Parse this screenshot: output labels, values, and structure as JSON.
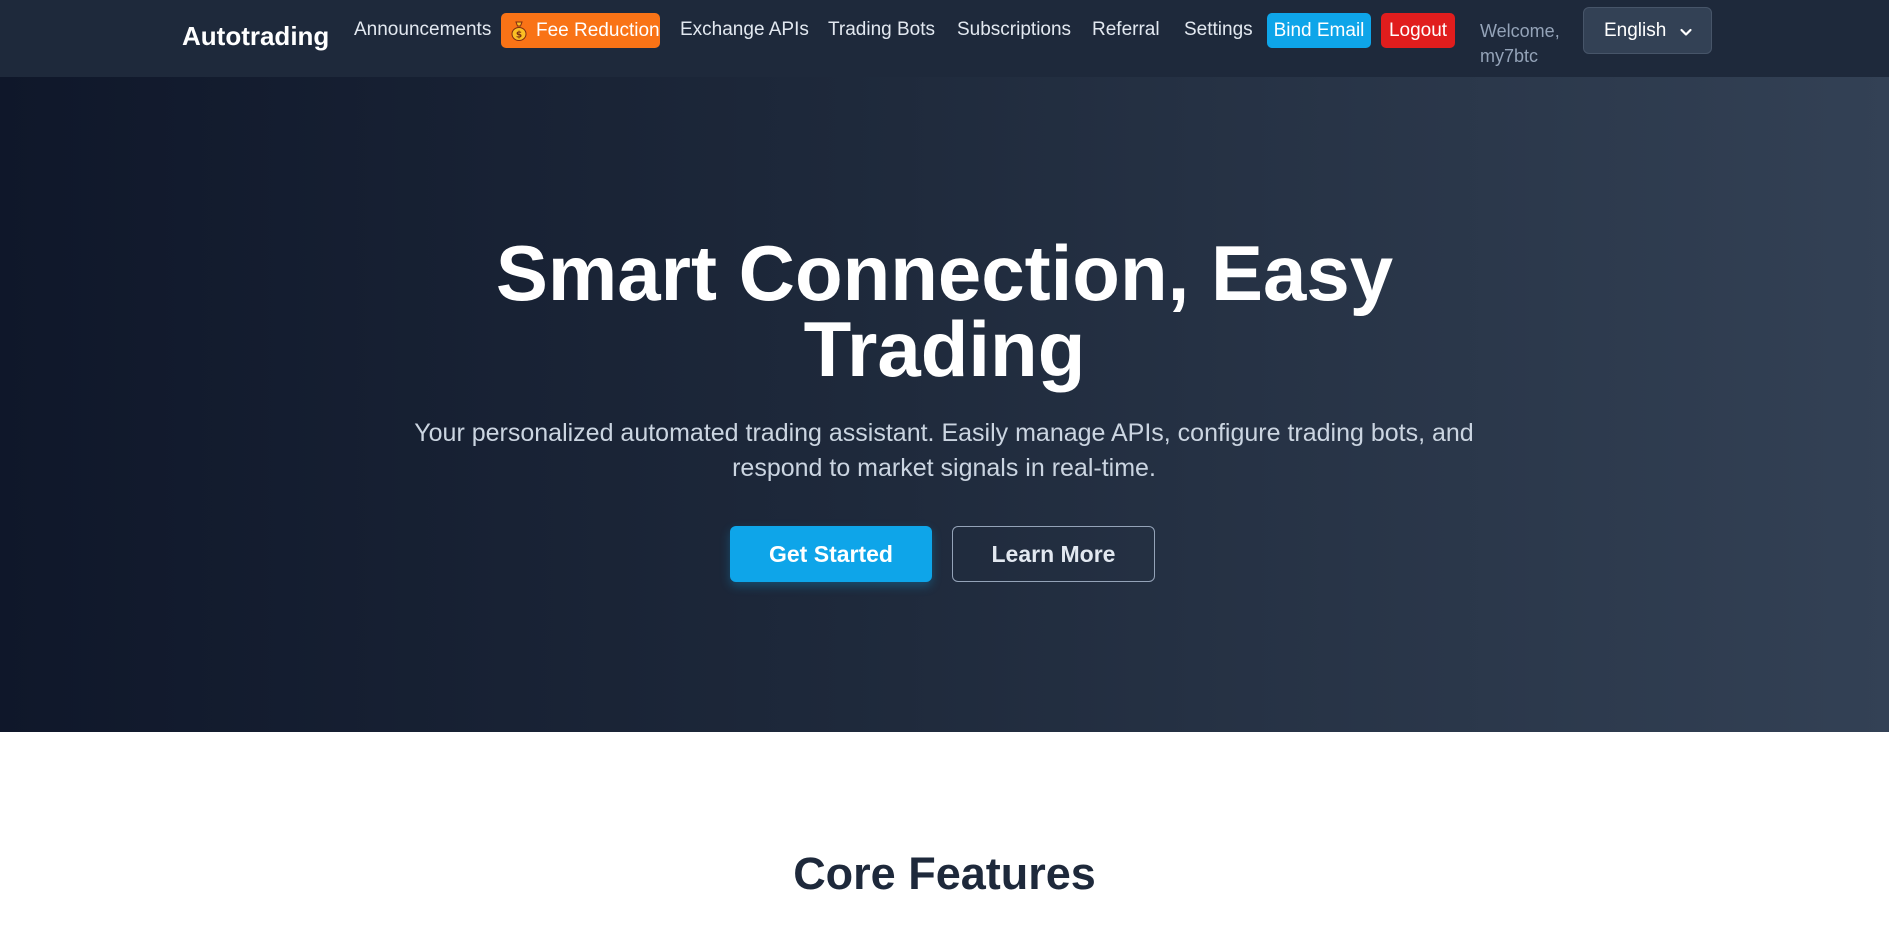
{
  "nav": {
    "brand": "Autotrading",
    "links": {
      "announcements": "Announcements",
      "fee_reduction": "Fee Reduction",
      "exchange_apis": "Exchange APIs",
      "trading_bots": "Trading Bots",
      "subscriptions": "Subscriptions",
      "referral": "Referral",
      "settings": "Settings"
    },
    "bind_email": "Bind Email",
    "logout": "Logout",
    "welcome_label": "Welcome,",
    "username": "my7btc",
    "language": "English",
    "icons": {
      "fee": "money-bag-icon",
      "language": "chevron-down-icon"
    }
  },
  "hero": {
    "title_line1": "Smart Connection, Easy",
    "title_line2": "Trading",
    "subtitle": "Your personalized automated trading assistant. Easily manage APIs, configure trading bots, and respond to market signals in real-time.",
    "primary_button": "Get Started",
    "secondary_button": "Learn More"
  },
  "features": {
    "title": "Core Features"
  },
  "colors": {
    "accent": "#0ea5e9",
    "fee_button": "#f97316",
    "logout": "#e11d1d",
    "nav_bg": "#1e293b"
  }
}
